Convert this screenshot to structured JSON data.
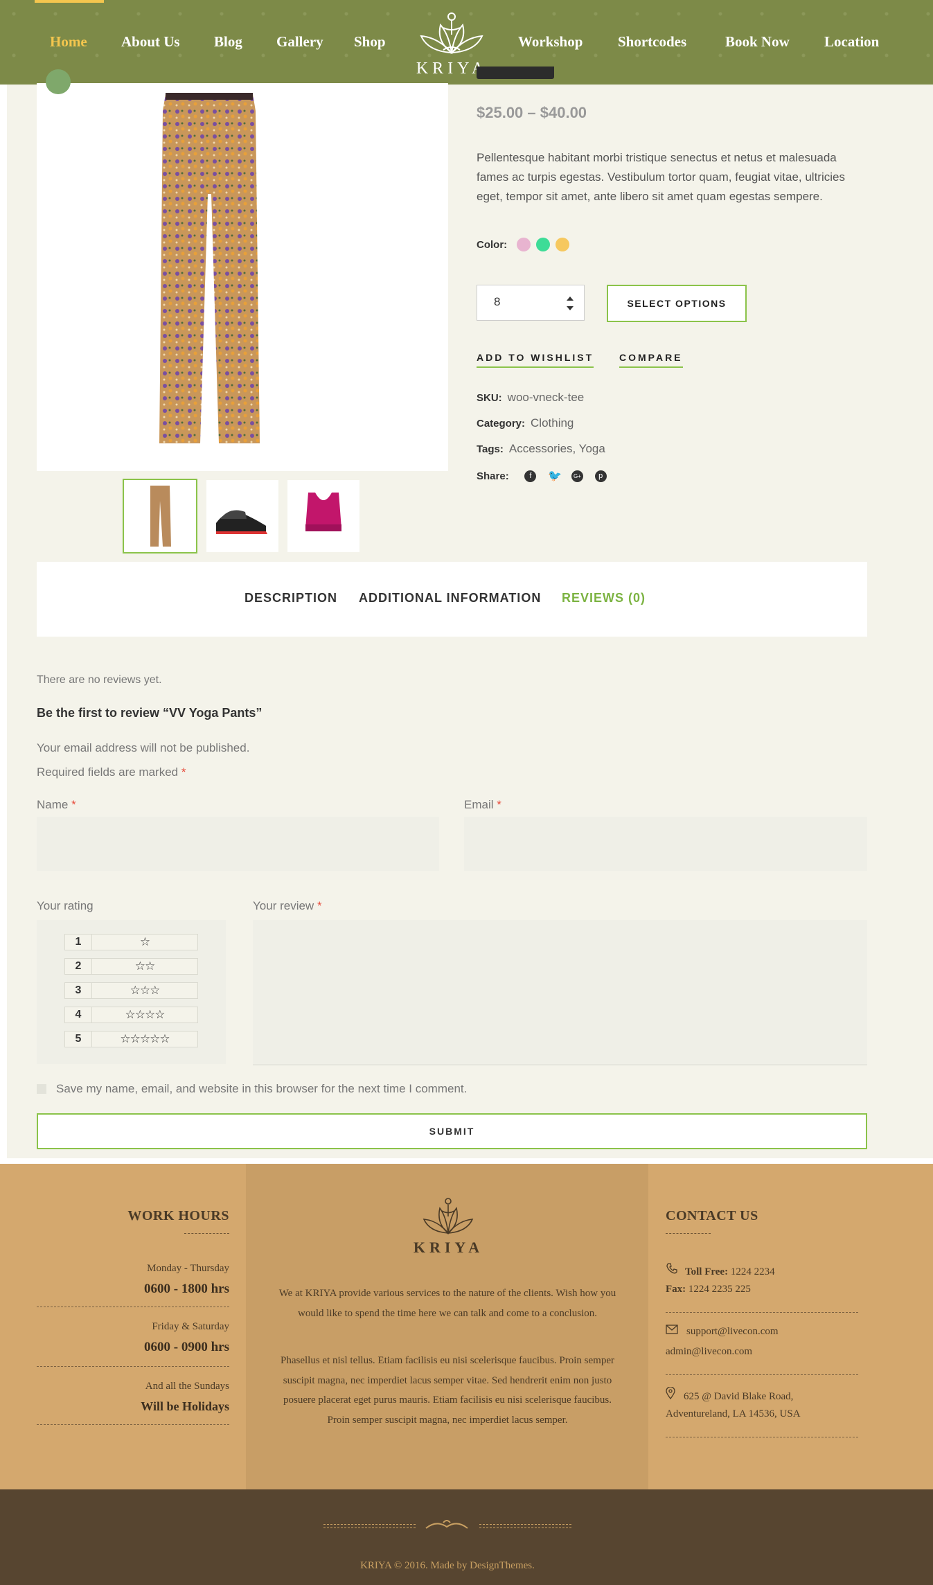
{
  "nav": {
    "left": [
      "Home",
      "About Us",
      "Blog",
      "Gallery",
      "Shop"
    ],
    "right": [
      "Workshop",
      "Shortcodes",
      "Book Now",
      "Location"
    ],
    "active": "Home",
    "logo_text": "KRIYA"
  },
  "product": {
    "price": "$25.00 – $40.00",
    "description": "Pellentesque habitant morbi tristique senectus et netus et malesuada fames ac turpis egestas. Vestibulum tortor quam, feugiat vitae, ultricies eget, tempor sit amet, ante libero sit amet quam egestas sempere.",
    "color_label": "Color:",
    "colors": [
      "#e8b4d0",
      "#3ddc97",
      "#f6c85f"
    ],
    "quantity": "8",
    "select_options": "SELECT OPTIONS",
    "add_to_wishlist": "ADD TO WISHLIST",
    "compare": "COMPARE",
    "sku_label": "SKU:",
    "sku": "woo-vneck-tee",
    "category_label": "Category:",
    "category": "Clothing",
    "tags_label": "Tags:",
    "tags": "Accessories, Yoga",
    "share_label": "Share:",
    "share_icons": [
      "facebook-icon",
      "twitter-icon",
      "google-plus-icon",
      "pinterest-icon"
    ]
  },
  "tabs": {
    "description": "DESCRIPTION",
    "additional": "ADDITIONAL INFORMATION",
    "reviews": "REVIEWS (0)"
  },
  "reviews": {
    "none": "There are no reviews yet.",
    "be_first": "Be the first to review “VV Yoga Pants”",
    "email_note": "Your email address will not be published.",
    "required_note": "Required fields are marked",
    "asterisk": "*",
    "name_label": "Name",
    "email_label": "Email",
    "rating_label": "Your rating",
    "review_label": "Your review",
    "ratings": [
      {
        "num": "1",
        "stars": "☆"
      },
      {
        "num": "2",
        "stars": "☆☆"
      },
      {
        "num": "3",
        "stars": "☆☆☆"
      },
      {
        "num": "4",
        "stars": "☆☆☆☆"
      },
      {
        "num": "5",
        "stars": "☆☆☆☆☆"
      }
    ],
    "save_info": "Save my name, email, and website in this browser for the next time I comment.",
    "submit": "SUBMIT"
  },
  "footer": {
    "work_hours_title": "WORK HOURS",
    "hours": [
      {
        "days": "Monday - Thursday",
        "time": "0600 - 1800 hrs"
      },
      {
        "days": "Friday & Saturday",
        "time": "0600 - 0900 hrs"
      },
      {
        "days": "And all the Sundays",
        "time": "Will be Holidays"
      }
    ],
    "logo_text": "KRIYA",
    "about_1": "We at KRIYA provide various services to the nature of the clients. Wish how you would like to spend the time here we can talk and come to a conclusion.",
    "about_2": "Phasellus et nisl tellus. Etiam facilisis eu nisi scelerisque faucibus. Proin semper suscipit magna, nec imperdiet lacus semper vitae. Sed hendrerit enim non justo posuere placerat eget purus mauris. Etiam facilisis eu nisi scelerisque faucibus. Proin semper suscipit magna, nec imperdiet lacus semper.",
    "contact_title": "CONTACT US",
    "toll_free_label": "Toll Free:",
    "toll_free": "1224 2234",
    "fax_label": "Fax:",
    "fax": "1224 2235 225",
    "email_1": "support@livecon.com",
    "email_2": "admin@livecon.com",
    "address_1": "625 @ David Blake Road,",
    "address_2": "Adventureland, LA 14536, USA",
    "copyright": "KRIYA © 2016. Made by DesignThemes."
  }
}
